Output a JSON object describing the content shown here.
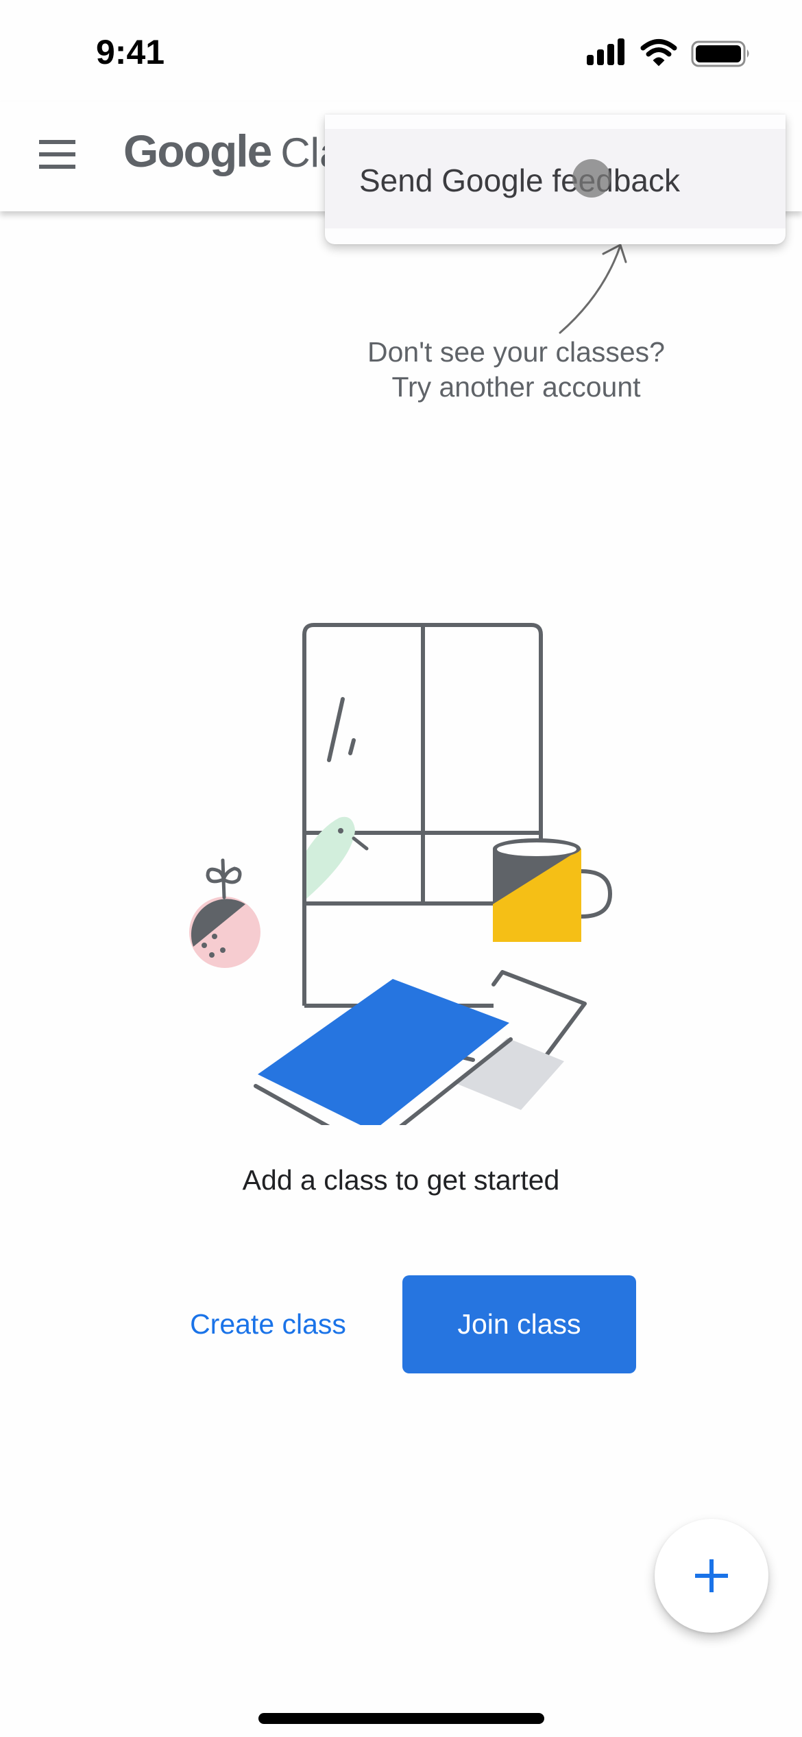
{
  "status_bar": {
    "time": "9:41",
    "icons": [
      "cellular-signal-icon",
      "wifi-icon",
      "battery-icon"
    ]
  },
  "app_bar": {
    "menu_icon": "hamburger-menu-icon",
    "logo_brand": "Google",
    "logo_product": "Classroom"
  },
  "overflow_menu": {
    "items": [
      {
        "label": "Send Google feedback"
      }
    ]
  },
  "hint": {
    "line1": "Don't see your classes?",
    "line2": "Try another account"
  },
  "empty_state": {
    "title": "Add a class to get started",
    "create_label": "Create class",
    "join_label": "Join class"
  },
  "fab": {
    "icon": "plus-icon"
  },
  "colors": {
    "accent": "#1a73e8",
    "button_fill": "#2675e0",
    "text_secondary": "#5f6368",
    "illustration_stroke": "#5f6368",
    "illustration_blue": "#2675e0",
    "illustration_yellow": "#f5bf16",
    "illustration_pink": "#f6ccd0",
    "illustration_mint": "#d2eedc",
    "illustration_gray": "#dadce0"
  }
}
